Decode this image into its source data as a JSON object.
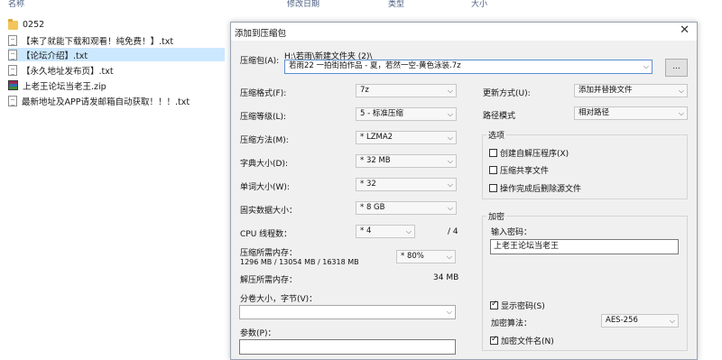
{
  "explorer": {
    "columns": [
      "名称",
      "修改日期",
      "类型",
      "大小"
    ],
    "files": [
      {
        "name": "0252",
        "icon": "folder-icon"
      },
      {
        "name": "【来了就能下载和观看！纯免费！】.txt",
        "icon": "text-file-icon"
      },
      {
        "name": "【论坛介绍】.txt",
        "icon": "text-file-icon"
      },
      {
        "name": "【永久地址发布页】.txt",
        "icon": "text-file-icon"
      },
      {
        "name": "上老王论坛当老王.zip",
        "icon": "zip-archive-icon"
      },
      {
        "name": "最新地址及APP请发邮箱自动获取！！！.txt",
        "icon": "text-file-icon"
      }
    ]
  },
  "dialog": {
    "title": "添加到压缩包",
    "close_glyph": "✕",
    "archive_label": "压缩包(A):",
    "archive_dir": "H:\\若雨\\新建文件夹 (2)\\",
    "archive_name": "若雨22 一拍街拍作品 - 夏，若然一空-黄色泳装.7z",
    "browse_label": "...",
    "format_label": "压缩格式(F):",
    "format_value": "7z",
    "level_label": "压缩等级(L):",
    "level_value": "5 - 标准压缩",
    "method_label": "压缩方法(M):",
    "method_value": "* LZMA2",
    "dict_label": "字典大小(D):",
    "dict_value": "* 32 MB",
    "word_label": "单词大小(W):",
    "word_value": "* 32",
    "solid_label": "固实数据大小：",
    "solid_value": "* 8 GB",
    "cpu_label": "CPU 线程数：",
    "cpu_value": "* 4",
    "cpu_total": "/ 4",
    "mem_label": "压缩所需内存：",
    "mem_detail": "1296 MB / 13054 MB / 16318 MB",
    "mem_value": "* 80%",
    "decomp_label": "解压所需内存：",
    "decomp_value": "34 MB",
    "split_label": "分卷大小，字节(V)：",
    "split_value": "",
    "params_label": "参数(P)：",
    "params_value": "",
    "update_label": "更新方式(U):",
    "update_value": "添加并替换文件",
    "path_label": "路径模式",
    "path_value": "相对路径",
    "options_label": "选项",
    "options": [
      {
        "label": "创建自解压程序(X)",
        "checked": false
      },
      {
        "label": "压缩共享文件",
        "checked": false
      },
      {
        "label": "操作完成后删除源文件",
        "checked": false
      }
    ],
    "encryption_label": "加密",
    "password_label": "输入密码：",
    "password_value": "上老王论坛当老王",
    "show_password_label": "显示密码(S)",
    "show_password_checked": true,
    "enc_method_label": "加密算法：",
    "enc_method_value": "AES-256",
    "encrypt_names_label": "加密文件名(N)",
    "encrypt_names_checked": true
  }
}
